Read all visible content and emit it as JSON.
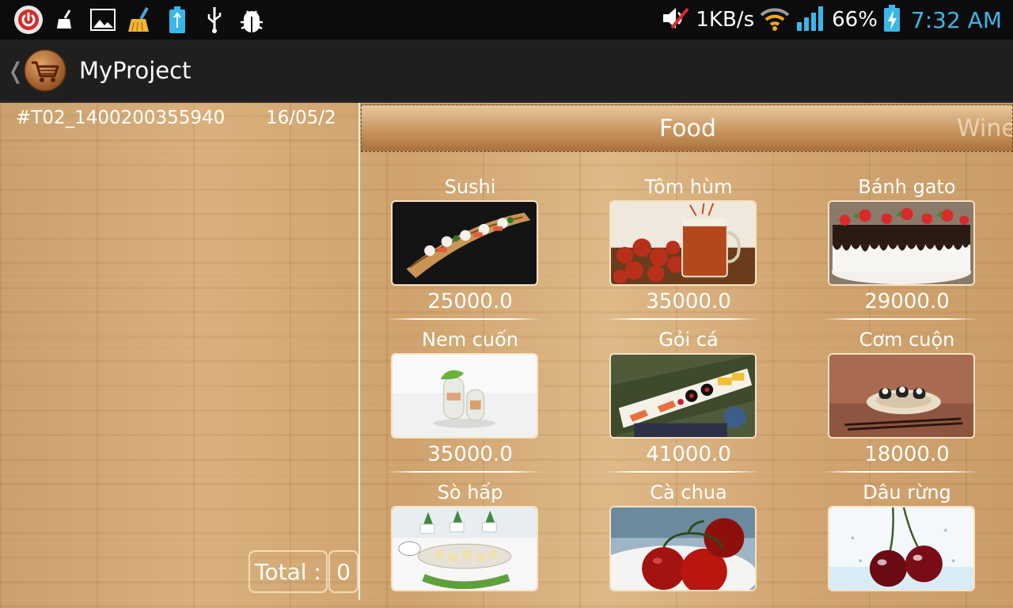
{
  "status_bar": {
    "left_icons": [
      "power-icon",
      "broom-icon",
      "image-icon",
      "cleaner-icon",
      "usb-battery-icon",
      "usb-icon",
      "bug-icon"
    ],
    "speed": "1KB/s",
    "battery": "66%",
    "time": "7:32 AM",
    "right_icons": [
      "mute-icon",
      "wifi-icon",
      "signal-icon",
      "battery-charging-icon"
    ]
  },
  "action_bar": {
    "title": "MyProject",
    "logo_icon": "shopping-cart-icon",
    "up_icon": "up-caret-icon"
  },
  "order": {
    "id": "#T02_1400200355940",
    "date": "16/05/2",
    "total_label": "Total :",
    "total_value": "0"
  },
  "tabs": [
    {
      "label": "Food",
      "active": true
    },
    {
      "label": "Wine",
      "active": false
    }
  ],
  "menu_items": [
    {
      "name": "Sushi",
      "price": "25000.0",
      "photo": "sushi-boat"
    },
    {
      "name": "Tôm hùm",
      "price": "35000.0",
      "photo": "crayfish-beer"
    },
    {
      "name": "Bánh gato",
      "price": "29000.0",
      "photo": "strawberry-cake"
    },
    {
      "name": "Nem cuốn",
      "price": "35000.0",
      "photo": "spring-rolls"
    },
    {
      "name": "Gỏi cá",
      "price": "41000.0",
      "photo": "sashimi-platter"
    },
    {
      "name": "Cơm cuộn",
      "price": "18000.0",
      "photo": "maki-bowl"
    },
    {
      "name": "Sò hấp",
      "price": "",
      "photo": "steamed-clams-table"
    },
    {
      "name": "Cà chua",
      "price": "",
      "photo": "tomatoes"
    },
    {
      "name": "Dâu rừng",
      "price": "",
      "photo": "cherries"
    }
  ],
  "colors": {
    "status_bar_bg": "#0c0c0c",
    "action_bar_bg": "#1f1f1f",
    "clock": "#39b7e8",
    "wood": "#d4a974"
  }
}
